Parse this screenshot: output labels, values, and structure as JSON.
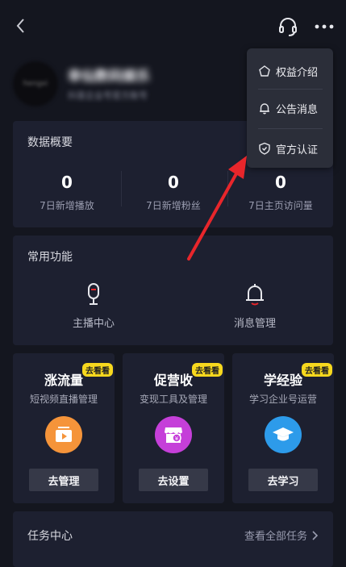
{
  "profile": {
    "name": "幸仙数码娱乐",
    "subtitle": "抖音企业号官方账号",
    "avatar_text": "hengxi"
  },
  "overview": {
    "title": "数据概要",
    "stats": [
      {
        "value": "0",
        "label": "7日新增播放"
      },
      {
        "value": "0",
        "label": "7日新增粉丝"
      },
      {
        "value": "0",
        "label": "7日主页访问量"
      }
    ]
  },
  "common": {
    "title": "常用功能",
    "items": [
      {
        "label": "主播中心",
        "icon": "microphone-icon"
      },
      {
        "label": "消息管理",
        "icon": "bell-icon"
      }
    ]
  },
  "promos": [
    {
      "title": "涨流量",
      "badge": "去看看",
      "desc": "短视频直播管理",
      "button": "去管理",
      "icon": "video-play-icon",
      "color": "#f5943a"
    },
    {
      "title": "促营收",
      "badge": "去看看",
      "desc": "变现工具及管理",
      "button": "去设置",
      "icon": "store-icon",
      "color": "#c53fd9"
    },
    {
      "title": "学经验",
      "badge": "去看看",
      "desc": "学习企业号运营",
      "button": "去学习",
      "icon": "graduation-cap-icon",
      "color": "#2d9bea"
    }
  ],
  "tasks": {
    "title": "任务中心",
    "view_all": "查看全部任务"
  },
  "menu": {
    "items": [
      {
        "label": "权益介绍",
        "icon": "pentagon-icon"
      },
      {
        "label": "公告消息",
        "icon": "bell-icon"
      },
      {
        "label": "官方认证",
        "icon": "shield-check-icon"
      }
    ]
  },
  "colors": {
    "background": "#14161f",
    "card": "#1d2030",
    "badge": "#f7d81e",
    "arrow": "#e8262b"
  }
}
